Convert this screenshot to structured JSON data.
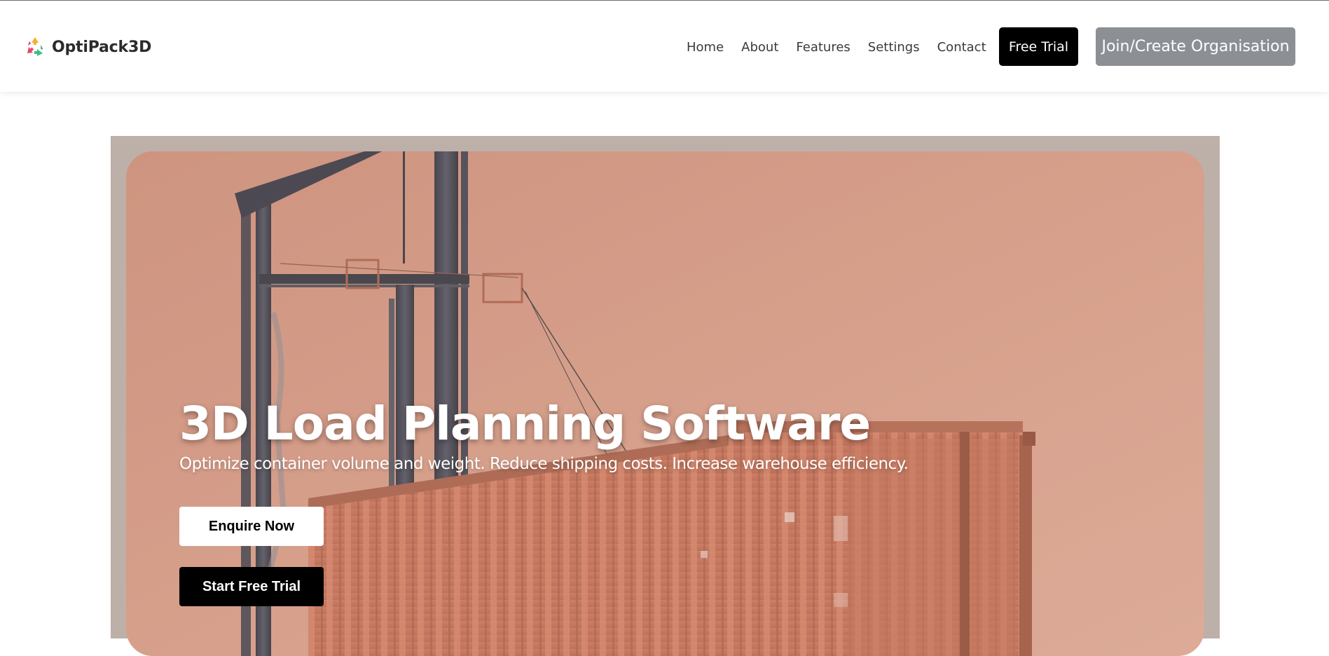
{
  "brand": {
    "name": "OptiPack3D",
    "logo_icon": "recycle-arrows-icon",
    "logo_colors": [
      "#f2b134",
      "#3fbf7f",
      "#e8456b"
    ]
  },
  "nav": {
    "links": [
      "Home",
      "About",
      "Features",
      "Settings",
      "Contact"
    ],
    "free_trial_label": "Free Trial",
    "join_label": "Join/Create Organisation"
  },
  "hero": {
    "title": "3D Load Planning Software",
    "subtitle": "Optimize container volume and weight. Reduce shipping costs. Increase warehouse efficiency.",
    "enquire_label": "Enquire Now",
    "start_trial_label": "Start Free Trial",
    "background_image": "shipping-containers-and-port-crane-photo"
  },
  "colors": {
    "hero_tint": "#d8a592",
    "frame": "#bdb0a9",
    "join_button": "#8c9095",
    "primary_button": "#000000"
  }
}
